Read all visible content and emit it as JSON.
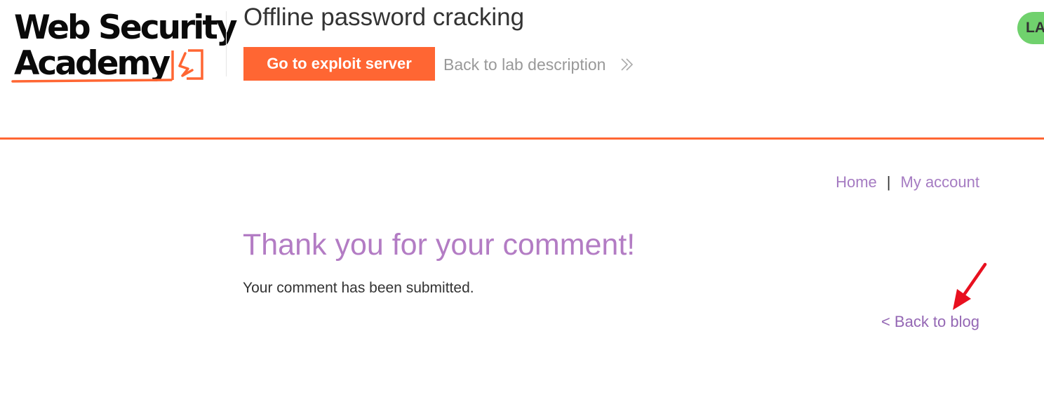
{
  "header": {
    "logo": {
      "line1": "Web Security",
      "line2": "Academy"
    },
    "lab_title": "Offline password cracking",
    "exploit_button_label": "Go to exploit server",
    "back_to_lab_label": "Back to lab description",
    "lab_status_label": "LA"
  },
  "nav": {
    "home_label": "Home",
    "separator": "|",
    "account_label": "My account"
  },
  "main": {
    "heading": "Thank you for your comment!",
    "message": "Your comment has been submitted.",
    "back_to_blog_label": "< Back to blog"
  },
  "colors": {
    "brand_orange": "#ff6633",
    "link_purple": "#a57bc2",
    "heading_purple": "#b37cc4",
    "status_green": "#70d16d",
    "annotation_red": "#e8101f"
  },
  "icons": {
    "logo_mark": "lightning-bolt-icon",
    "back_chevron": "double-chevron-right-icon",
    "annotation": "red-arrow-icon"
  }
}
